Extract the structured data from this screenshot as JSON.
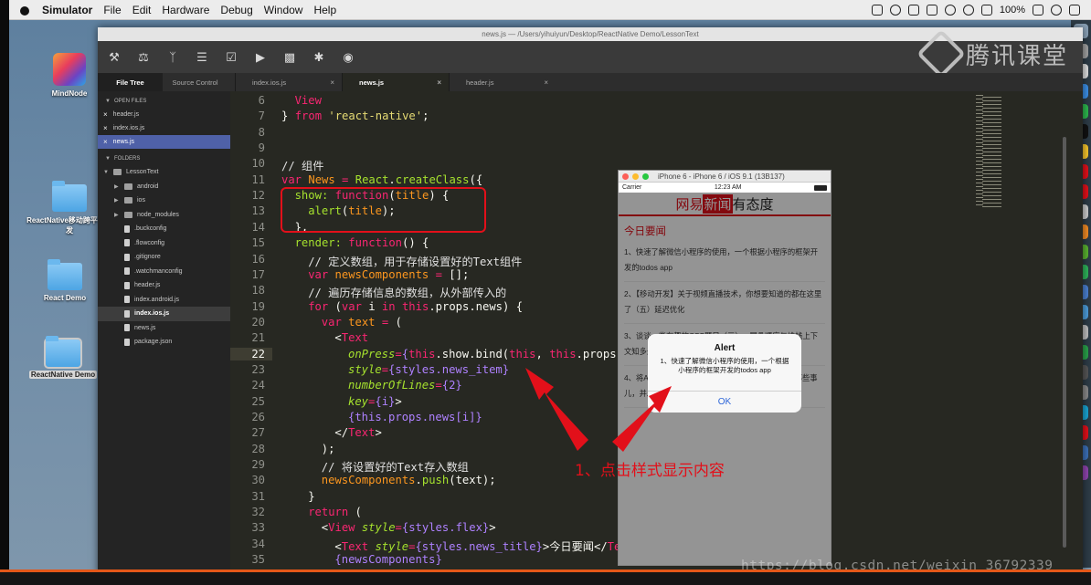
{
  "menubar": {
    "app": "Simulator",
    "items": [
      "File",
      "Edit",
      "Hardware",
      "Debug",
      "Window",
      "Help"
    ],
    "battery": "100%"
  },
  "desktop": {
    "icons": [
      {
        "label": "MindNode",
        "kind": "mindnode"
      },
      {
        "label": "ReactNative移动跨平台开发",
        "kind": "folder"
      },
      {
        "label": "React Demo",
        "kind": "folder"
      },
      {
        "label": "ReactNative Demo",
        "kind": "folder",
        "selected": true
      }
    ]
  },
  "editor": {
    "window_title": "news.js — /Users/yihuiyun/Desktop/ReactNative Demo/LessonText",
    "watermark": "腾讯课堂",
    "toolbar_icons": [
      "wrench-icon",
      "scale-icon",
      "branch-icon",
      "list-icon",
      "checklist-icon",
      "play-icon",
      "terminal-icon",
      "plugin-icon",
      "eye-icon"
    ],
    "side_tabs": [
      "File Tree",
      "Source Control"
    ],
    "file_tabs": [
      "index.ios.js",
      "news.js",
      "header.js"
    ],
    "active_file_tab": "news.js",
    "open_files_header": "OPEN FILES",
    "open_files": [
      "header.js",
      "index.ios.js",
      "news.js"
    ],
    "folders_header": "FOLDERS",
    "project": "LessonText",
    "tree": [
      {
        "name": "android",
        "type": "folder"
      },
      {
        "name": "ios",
        "type": "folder"
      },
      {
        "name": "node_modules",
        "type": "folder"
      },
      {
        "name": ".buckconfig",
        "type": "file"
      },
      {
        "name": ".flowconfig",
        "type": "file"
      },
      {
        "name": ".gitignore",
        "type": "file"
      },
      {
        "name": ".watchmanconfig",
        "type": "file"
      },
      {
        "name": "header.js",
        "type": "file"
      },
      {
        "name": "index.android.js",
        "type": "file"
      },
      {
        "name": "index.ios.js",
        "type": "file",
        "active": true
      },
      {
        "name": "news.js",
        "type": "file"
      },
      {
        "name": "package.json",
        "type": "file"
      }
    ],
    "current_line": 22,
    "code": [
      {
        "n": 6,
        "indent": 1,
        "t": [
          [
            "View",
            "kw"
          ]
        ]
      },
      {
        "n": 7,
        "indent": 0,
        "t": [
          [
            "} ",
            ""
          ],
          [
            "from",
            "kw"
          ],
          [
            " 'react-native'",
            "st"
          ],
          [
            ";",
            ""
          ]
        ]
      },
      {
        "n": 8,
        "indent": 0,
        "t": []
      },
      {
        "n": 9,
        "indent": 0,
        "t": []
      },
      {
        "n": 10,
        "indent": 0,
        "t": [
          [
            "// 组件",
            "cm"
          ]
        ]
      },
      {
        "n": 11,
        "indent": 0,
        "t": [
          [
            "var",
            "kw"
          ],
          [
            " News ",
            "sp"
          ],
          [
            "= ",
            "kw"
          ],
          [
            "React",
            "fn"
          ],
          [
            ".",
            ""
          ],
          [
            "createClass",
            "fn"
          ],
          [
            "({",
            ""
          ]
        ]
      },
      {
        "n": 12,
        "indent": 1,
        "t": [
          [
            "show: ",
            "fn"
          ],
          [
            "function",
            "kw"
          ],
          [
            "(",
            ""
          ],
          [
            "title",
            "sp"
          ],
          [
            ") {",
            ""
          ]
        ]
      },
      {
        "n": 13,
        "indent": 2,
        "t": [
          [
            "alert",
            "fn"
          ],
          [
            "(",
            ""
          ],
          [
            "title",
            "sp"
          ],
          [
            ");",
            ""
          ]
        ]
      },
      {
        "n": 14,
        "indent": 1,
        "t": [
          [
            "},",
            ""
          ]
        ]
      },
      {
        "n": 15,
        "indent": 1,
        "t": [
          [
            "render: ",
            "fn"
          ],
          [
            "function",
            "kw"
          ],
          [
            "() {",
            ""
          ]
        ]
      },
      {
        "n": 16,
        "indent": 2,
        "t": [
          [
            "// 定义数组，用于存储设置好的Text组件",
            "cm"
          ]
        ]
      },
      {
        "n": 17,
        "indent": 2,
        "t": [
          [
            "var",
            "kw"
          ],
          [
            " newsComponents ",
            "sp"
          ],
          [
            "= ",
            "kw"
          ],
          [
            "[];",
            ""
          ]
        ]
      },
      {
        "n": 18,
        "indent": 2,
        "t": [
          [
            "// 遍历存储信息的数组，从外部传入的",
            "cm"
          ]
        ]
      },
      {
        "n": 19,
        "indent": 2,
        "t": [
          [
            "for",
            "kw"
          ],
          [
            " (",
            ""
          ],
          [
            "var",
            "kw"
          ],
          [
            " i ",
            ""
          ],
          [
            "in",
            "kw"
          ],
          [
            " ",
            ""
          ],
          [
            "this",
            "kw"
          ],
          [
            ".props.news) {",
            ""
          ]
        ]
      },
      {
        "n": 20,
        "indent": 3,
        "t": [
          [
            "var",
            "kw"
          ],
          [
            " text ",
            "sp"
          ],
          [
            "= ",
            "kw"
          ],
          [
            "(",
            ""
          ]
        ]
      },
      {
        "n": 21,
        "indent": 4,
        "t": [
          [
            "<",
            ""
          ],
          [
            "Text",
            "kw"
          ]
        ]
      },
      {
        "n": 22,
        "indent": 5,
        "t": [
          [
            "onPress",
            "at"
          ],
          [
            "=",
            "kw"
          ],
          [
            "{",
            "pu"
          ],
          [
            "this",
            "kw"
          ],
          [
            ".show.bind(",
            ""
          ],
          [
            "this",
            "kw"
          ],
          [
            ", ",
            ""
          ],
          [
            "this",
            "kw"
          ],
          [
            ".props.n",
            ""
          ]
        ]
      },
      {
        "n": 23,
        "indent": 5,
        "t": [
          [
            "style",
            "at"
          ],
          [
            "=",
            "kw"
          ],
          [
            "{styles.news_item}",
            "pu"
          ]
        ]
      },
      {
        "n": 24,
        "indent": 5,
        "t": [
          [
            "numberOfLines",
            "at"
          ],
          [
            "=",
            "kw"
          ],
          [
            "{2}",
            "pu"
          ]
        ]
      },
      {
        "n": 25,
        "indent": 5,
        "t": [
          [
            "key",
            "at"
          ],
          [
            "=",
            "kw"
          ],
          [
            "{i}",
            "pu"
          ],
          [
            ">",
            ""
          ]
        ]
      },
      {
        "n": 26,
        "indent": 5,
        "t": [
          [
            "{this.props.news[i]}",
            "pu"
          ]
        ]
      },
      {
        "n": 27,
        "indent": 4,
        "t": [
          [
            "</",
            ""
          ],
          [
            "Text",
            "kw"
          ],
          [
            ">",
            ""
          ]
        ]
      },
      {
        "n": 28,
        "indent": 3,
        "t": [
          [
            ");",
            ""
          ]
        ]
      },
      {
        "n": 29,
        "indent": 3,
        "t": [
          [
            "// 将设置好的Text存入数组",
            "cm"
          ]
        ]
      },
      {
        "n": 30,
        "indent": 3,
        "t": [
          [
            "newsComponents",
            "sp"
          ],
          [
            ".",
            ""
          ],
          [
            "push",
            "fn"
          ],
          [
            "(text);",
            ""
          ]
        ]
      },
      {
        "n": 31,
        "indent": 2,
        "t": [
          [
            "}",
            ""
          ]
        ]
      },
      {
        "n": 32,
        "indent": 2,
        "t": [
          [
            "return",
            "kw"
          ],
          [
            " (",
            ""
          ]
        ]
      },
      {
        "n": 33,
        "indent": 3,
        "t": [
          [
            "<",
            ""
          ],
          [
            "View",
            "kw"
          ],
          [
            " ",
            ""
          ],
          [
            "style",
            "at"
          ],
          [
            "=",
            "kw"
          ],
          [
            "{styles.flex}",
            "pu"
          ],
          [
            ">",
            ""
          ]
        ]
      },
      {
        "n": 34,
        "indent": 4,
        "t": [
          [
            "<",
            ""
          ],
          [
            "Text",
            "kw"
          ],
          [
            " ",
            ""
          ],
          [
            "style",
            "at"
          ],
          [
            "=",
            "kw"
          ],
          [
            "{styles.news_title}",
            "pu"
          ],
          [
            ">今日要闻</",
            ""
          ],
          [
            "Tex",
            "kw"
          ]
        ]
      },
      {
        "n": 35,
        "indent": 4,
        "t": [
          [
            "{newsComponents}",
            "pu"
          ]
        ]
      },
      {
        "n": 36,
        "indent": 3,
        "t": [
          [
            "</",
            ""
          ],
          [
            "View",
            "kw"
          ],
          [
            ">",
            ""
          ]
        ]
      }
    ]
  },
  "simulator": {
    "title": "iPhone 6 - iPhone 6 / iOS 9.1 (13B137)",
    "carrier": "Carrier",
    "time": "12:23 AM",
    "app_title_parts": [
      "网易",
      "新闻",
      "有态度"
    ],
    "news_title": "今日要闻",
    "news": [
      "1、快速了解微信小程序的使用，一个根据小程序的框架开发的todos app",
      "2、【移动开发】关于视频直播技术，你想要知道的都在这里了（五）延迟优化",
      "3、谈谈一些有趣的CSS题目（三）-- 层叠顺序与堆栈上下文知多少",
      "4、将Android项目迁移到Kotlin语言，你需要了解的那些事儿，并发工程"
    ],
    "alert": {
      "title": "Alert",
      "message": "1、快速了解微信小程序的使用，一个根据小程序的框架开发的todos app",
      "button": "OK"
    }
  },
  "annotation": "1、点击样式显示内容",
  "csdn_watermark": "https://blog.csdn.net/weixin_36792339"
}
